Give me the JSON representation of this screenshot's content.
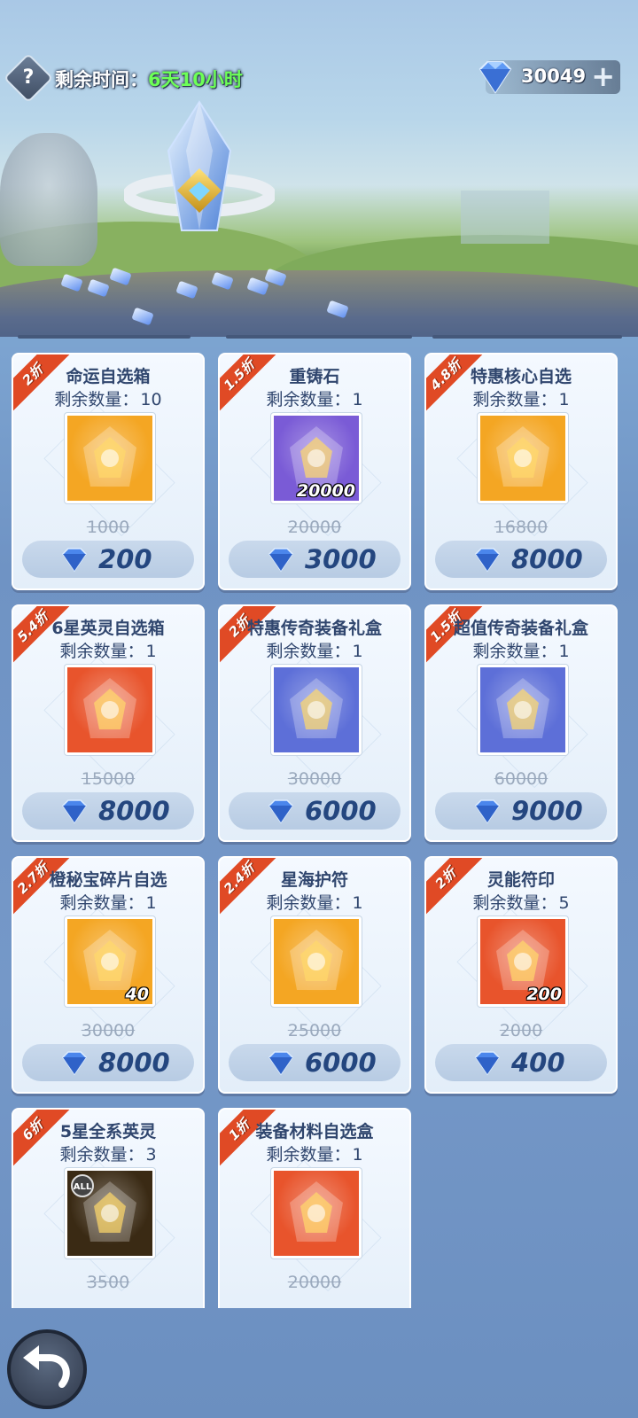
{
  "header": {
    "help_icon": "question-icon",
    "timer_label": "剩余时间：",
    "timer_value": "6天10小时",
    "currency_amount": "30049",
    "currency_plus": "+"
  },
  "items": [
    {
      "discount": "2折",
      "name": "命运自选箱",
      "remain_label": "剩余数量：",
      "remain": "10",
      "qty": "",
      "orig": "1000",
      "price": "200",
      "icon": "golden-chest-icon",
      "bg": "#f4a623"
    },
    {
      "discount": "1.5折",
      "name": "重铸石",
      "remain_label": "剩余数量：",
      "remain": "1",
      "qty": "20000",
      "orig": "20000",
      "price": "3000",
      "icon": "blue-crystal-stone-icon",
      "bg": "#7a5bd6"
    },
    {
      "discount": "4.8折",
      "name": "特惠核心自选",
      "remain_label": "剩余数量：",
      "remain": "1",
      "qty": "",
      "orig": "16800",
      "price": "8000",
      "icon": "core-card-icon",
      "bg": "#f4a623"
    },
    {
      "discount": "5.4折",
      "name": "6星英灵自选箱",
      "remain_label": "剩余数量：",
      "remain": "1",
      "qty": "",
      "orig": "15000",
      "price": "8000",
      "icon": "golden-helmet-icon",
      "bg": "#e8542c"
    },
    {
      "discount": "2折",
      "name": "特惠传奇装备礼盒",
      "remain_label": "剩余数量：",
      "remain": "1",
      "qty": "",
      "orig": "30000",
      "price": "6000",
      "icon": "legend-armor-icon",
      "bg": "#5d6fd8"
    },
    {
      "discount": "1.5折",
      "name": "超值传奇装备礼盒",
      "remain_label": "剩余数量：",
      "remain": "1",
      "qty": "",
      "orig": "60000",
      "price": "9000",
      "icon": "legend-armor-icon",
      "bg": "#5d6fd8"
    },
    {
      "discount": "2.7折",
      "name": "橙秘宝碎片自选",
      "remain_label": "剩余数量：",
      "remain": "1",
      "qty": "40",
      "orig": "30000",
      "price": "8000",
      "icon": "treasure-altar-icon",
      "bg": "#f4a623"
    },
    {
      "discount": "2.4折",
      "name": "星海护符",
      "remain_label": "剩余数量：",
      "remain": "1",
      "qty": "",
      "orig": "25000",
      "price": "6000",
      "icon": "amulet-icon",
      "bg": "#f4a623"
    },
    {
      "discount": "2折",
      "name": "灵能符印",
      "remain_label": "剩余数量：",
      "remain": "5",
      "qty": "200",
      "orig": "2000",
      "price": "400",
      "icon": "purple-rune-icon",
      "bg": "#e8542c"
    },
    {
      "discount": "6折",
      "name": "5星全系英灵",
      "remain_label": "剩余数量：",
      "remain": "3",
      "qty": "",
      "orig": "3500",
      "price": "",
      "icon": "all-hero-mask-icon",
      "bg": "#3a2a14",
      "extra": "ALL"
    },
    {
      "discount": "1折",
      "name": "装备材料自选盒",
      "remain_label": "剩余数量：",
      "remain": "1",
      "qty": "",
      "orig": "20000",
      "price": "",
      "icon": "equipment-material-icon",
      "bg": "#e8542c"
    }
  ],
  "colors": {
    "ribbon": "#e04a25",
    "price": "#24467f",
    "timer_value": "#6dff57"
  }
}
